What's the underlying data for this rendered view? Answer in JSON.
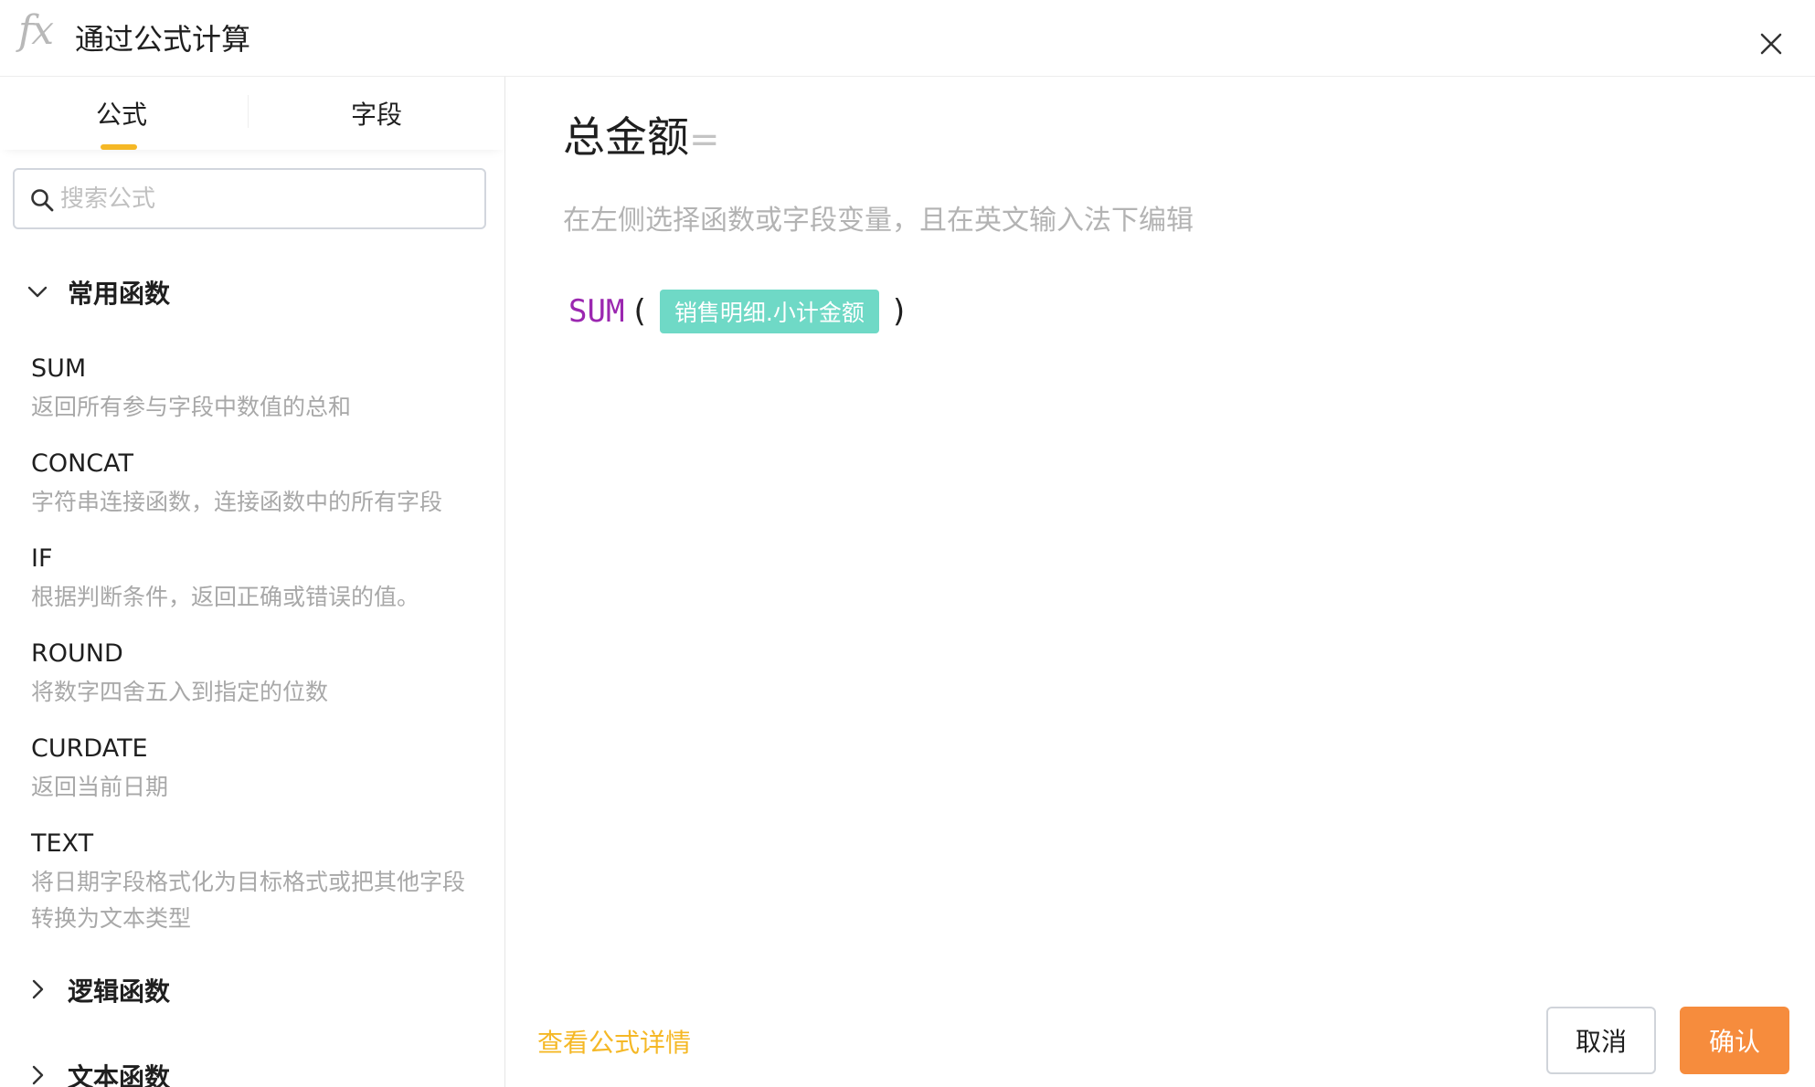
{
  "header": {
    "icon": "fx-icon",
    "icon_text": "fx",
    "title": "通过公式计算",
    "close_icon": "close-icon"
  },
  "left_panel": {
    "tabs": [
      {
        "label": "公式",
        "active": true
      },
      {
        "label": "字段",
        "active": false
      }
    ],
    "search": {
      "placeholder": "搜索公式",
      "value": "",
      "icon": "search-icon"
    },
    "categories": [
      {
        "label": "常用函数",
        "expanded": true,
        "functions": [
          {
            "name": "SUM",
            "desc": "返回所有参与字段中数值的总和"
          },
          {
            "name": "CONCAT",
            "desc": "字符串连接函数，连接函数中的所有字段"
          },
          {
            "name": "IF",
            "desc": "根据判断条件，返回正确或错误的值。"
          },
          {
            "name": "ROUND",
            "desc": "将数字四舍五入到指定的位数"
          },
          {
            "name": "CURDATE",
            "desc": "返回当前日期"
          },
          {
            "name": "TEXT",
            "desc": "将日期字段格式化为目标格式或把其他字段转换为文本类型"
          }
        ]
      },
      {
        "label": "逻辑函数",
        "expanded": false
      },
      {
        "label": "文本函数",
        "expanded": false
      }
    ]
  },
  "editor": {
    "field_name": "总金额",
    "equals": "=",
    "hint": "在左侧选择函数或字段变量，且在英文输入法下编辑",
    "formula": {
      "function": "SUM",
      "open_paren": "(",
      "field_chip": "销售明细.小计金额",
      "close_paren": ")"
    }
  },
  "footer": {
    "details_link": "查看公式详情",
    "cancel_label": "取消",
    "confirm_label": "确认"
  },
  "colors": {
    "accent": "#f5b826",
    "confirm": "#f68c3d",
    "function_token": "#9b27b0",
    "field_chip": "#6fd9c6"
  }
}
